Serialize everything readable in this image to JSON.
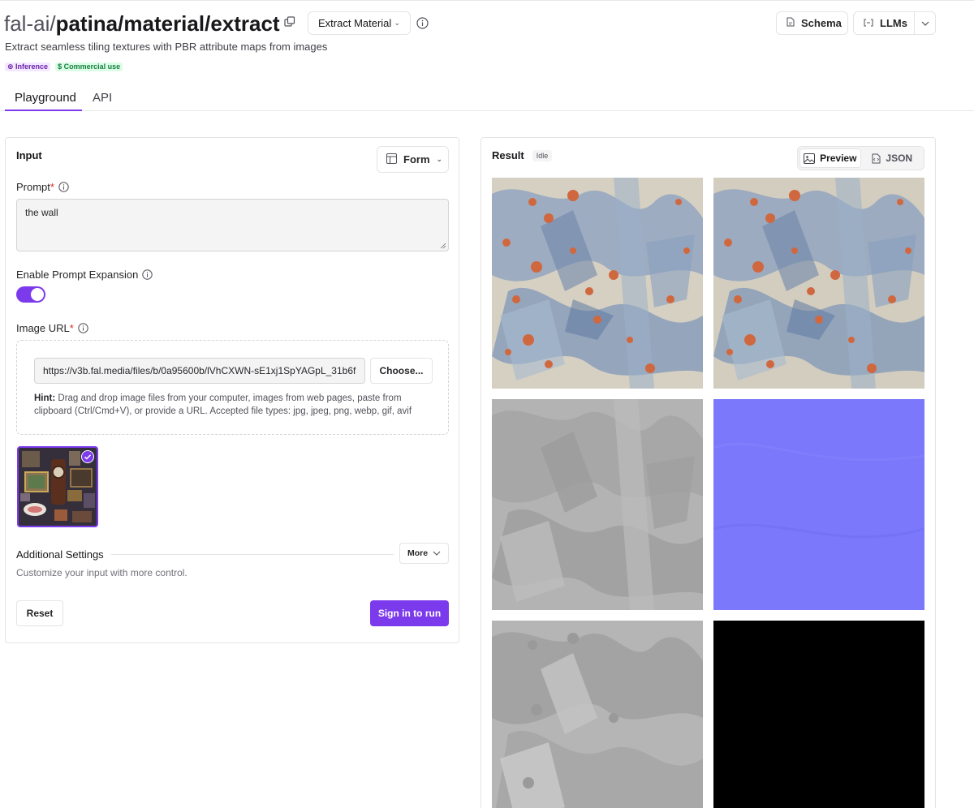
{
  "header": {
    "owner": "fal-ai/",
    "slug": "patina/material/extract",
    "model_select": "Extract Material",
    "subtitle": "Extract seamless tiling textures with PBR attribute maps from images",
    "badges": [
      "⊗ Inference",
      "$ Commercial use"
    ],
    "schema_label": "Schema",
    "llms_label": "LLMs"
  },
  "tabs": [
    "Playground",
    "API"
  ],
  "input": {
    "heading": "Input",
    "form_label": "Form",
    "prompt_label": "Prompt",
    "prompt_value": "the wall",
    "expansion_label": "Enable Prompt Expansion",
    "expansion_on": true,
    "image_url_label": "Image URL",
    "image_url_value": "https://v3b.fal.media/files/b/0a95600b/lVhCXWN-sE1xj1SpYAGpL_31b6f",
    "choose_label": "Choose...",
    "hint_bold": "Hint:",
    "hint_text": " Drag and drop image files from your computer, images from web pages, paste from clipboard (Ctrl/Cmd+V), or provide a URL. Accepted file types: jpg, jpeg, png, webp, gif, avif",
    "additional_settings": "Additional Settings",
    "more_label": "More",
    "additional_desc": "Customize your input with more control.",
    "reset_label": "Reset",
    "run_label": "Sign in to run"
  },
  "result": {
    "heading": "Result",
    "status": "Idle",
    "preview_label": "Preview",
    "json_label": "JSON"
  },
  "colors": {
    "accent": "#7c3aed",
    "normal_map": "#7f7fff",
    "metallic_map": "#000000"
  }
}
